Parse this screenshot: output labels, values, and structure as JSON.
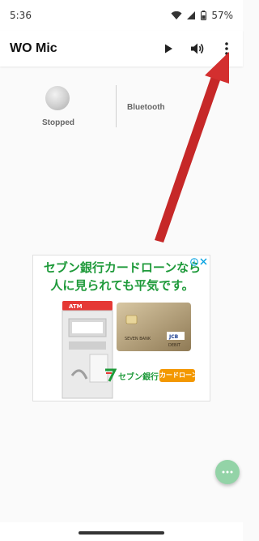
{
  "status_bar": {
    "time": "5:36",
    "battery_percent": "57%",
    "icons": [
      "wifi-icon",
      "signal-icon",
      "battery-icon"
    ]
  },
  "toolbar": {
    "title": "WO Mic",
    "actions": [
      "play-icon",
      "volume-icon",
      "overflow-menu-icon"
    ]
  },
  "main": {
    "connection_status": "Stopped",
    "transport": "Bluetooth"
  },
  "ad": {
    "headline_line1": "セブン銀行カードローンなら",
    "headline_line2": "人に見られても平気です。",
    "atm_label": "ATM",
    "bank_name": "セブン銀行",
    "product_badge": "カードローン",
    "card_brand": "SEVEN BANK",
    "card_network": "JCB",
    "card_type": "DEBIT"
  },
  "colors": {
    "ad_green": "#1e9a3a",
    "badge_orange": "#f39800",
    "fab_green": "#93d3a7",
    "arrow_red": "#d32f2f"
  }
}
